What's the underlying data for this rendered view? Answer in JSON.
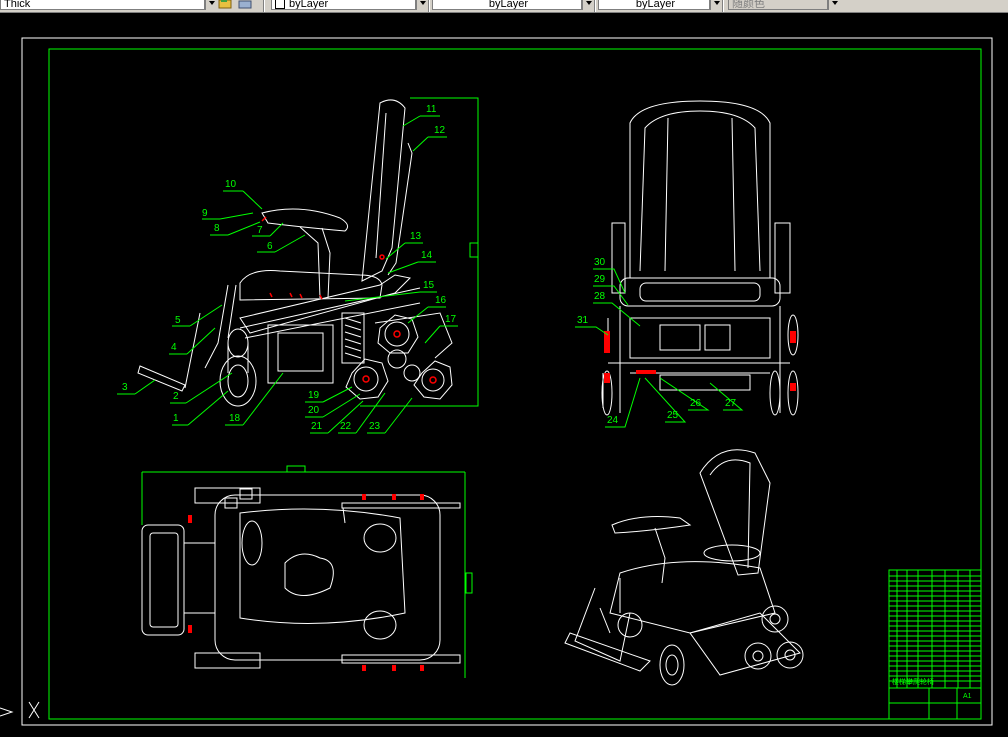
{
  "toolbar": {
    "linetype_value": "Thick",
    "layer_value": "byLayer",
    "linetype_control": "byLayer",
    "lineweight_control": "byLayer",
    "plotstyle_value": "随颜色"
  },
  "drawing": {
    "part_labels": [
      "1",
      "2",
      "3",
      "4",
      "5",
      "6",
      "7",
      "8",
      "9",
      "10",
      "11",
      "12",
      "13",
      "14",
      "15",
      "16",
      "17",
      "18",
      "19",
      "20",
      "21",
      "22",
      "23",
      "24",
      "25",
      "26",
      "27",
      "28",
      "29",
      "30",
      "31"
    ],
    "title_block_name": "楼梯攀爬轮椅",
    "title_block_scale": "A1"
  },
  "ucs_icon": "ucs-x-axis-icon",
  "colors": {
    "background": "#000000",
    "border_outer": "#ffffff",
    "border_inner": "#00ff00",
    "leader": "#00ff00",
    "geometry": "#ffffff",
    "highlight": "#ff0000"
  }
}
